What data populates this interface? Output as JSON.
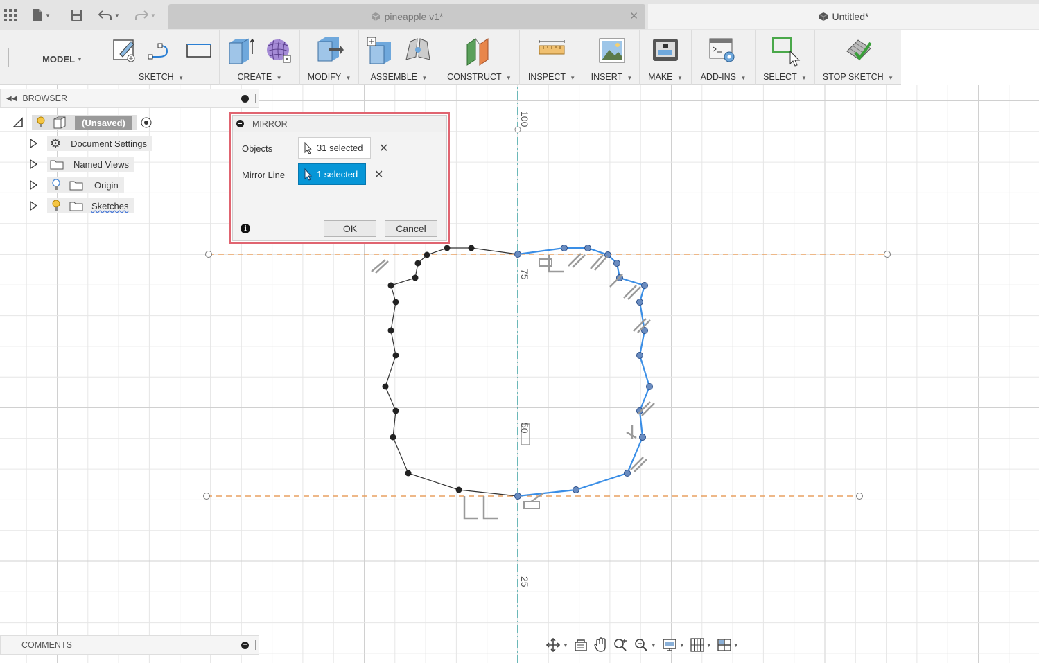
{
  "document_tabs": [
    {
      "label": "pineapple v1*",
      "active": false,
      "close_glyph": "✕"
    },
    {
      "label": "Untitled*",
      "active": true
    }
  ],
  "quick_access": {
    "app_grid_icon": "app-grid-icon",
    "file_icon": "file-icon",
    "save_icon": "save-icon",
    "undo_icon": "undo-icon",
    "redo_icon": "redo-icon"
  },
  "workspace": {
    "label": "MODEL"
  },
  "toolbar_groups": [
    {
      "label": "SKETCH",
      "icons": [
        "create-sketch-icon",
        "line-icon",
        "rectangle-icon"
      ]
    },
    {
      "label": "CREATE",
      "icons": [
        "extrude-icon",
        "form-icon"
      ]
    },
    {
      "label": "MODIFY",
      "icons": [
        "press-pull-icon"
      ]
    },
    {
      "label": "ASSEMBLE",
      "icons": [
        "new-component-icon",
        "joint-icon"
      ]
    },
    {
      "label": "CONSTRUCT",
      "icons": [
        "offset-plane-icon"
      ]
    },
    {
      "label": "INSPECT",
      "icons": [
        "measure-icon"
      ]
    },
    {
      "label": "INSERT",
      "icons": [
        "insert-image-icon"
      ]
    },
    {
      "label": "MAKE",
      "icons": [
        "3d-print-icon"
      ]
    },
    {
      "label": "ADD-INS",
      "icons": [
        "scripts-addins-icon"
      ]
    },
    {
      "label": "SELECT",
      "icons": [
        "select-icon"
      ]
    },
    {
      "label": "STOP SKETCH",
      "icons": [
        "stop-sketch-icon"
      ]
    }
  ],
  "browser": {
    "title": "BROWSER",
    "root": {
      "label": "(Unsaved)"
    },
    "items": [
      {
        "label": "Document Settings",
        "icon": "gear-icon"
      },
      {
        "label": "Named Views",
        "icon": "folder-icon"
      },
      {
        "label": "Origin",
        "icon": "folder-icon",
        "lightbulb": "off"
      },
      {
        "label": "Sketches",
        "icon": "folder-icon",
        "lightbulb": "on"
      }
    ]
  },
  "comments": {
    "title": "COMMENTS"
  },
  "mirror_dialog": {
    "title": "MIRROR",
    "objects_label": "Objects",
    "objects_value": "31 selected",
    "mirror_line_label": "Mirror Line",
    "mirror_line_value": "1 selected",
    "ok_label": "OK",
    "cancel_label": "Cancel"
  },
  "canvas": {
    "ruler_labels": [
      "100",
      "75",
      "50",
      "25"
    ],
    "colors": {
      "grid": "#e6e6e6",
      "grid_major": "#d0d0d0",
      "axis": "#3aa0a0",
      "construction": "#e8a060",
      "sketch_line": "#333333",
      "selected_line": "#3a8ee6",
      "constraint": "#9a9a9a"
    }
  },
  "navbar": {
    "icons": [
      "orbit-icon",
      "look-at-icon",
      "pan-icon",
      "zoom-window-icon",
      "zoom-icon",
      "display-settings-icon",
      "grid-settings-icon",
      "viewports-icon"
    ]
  }
}
